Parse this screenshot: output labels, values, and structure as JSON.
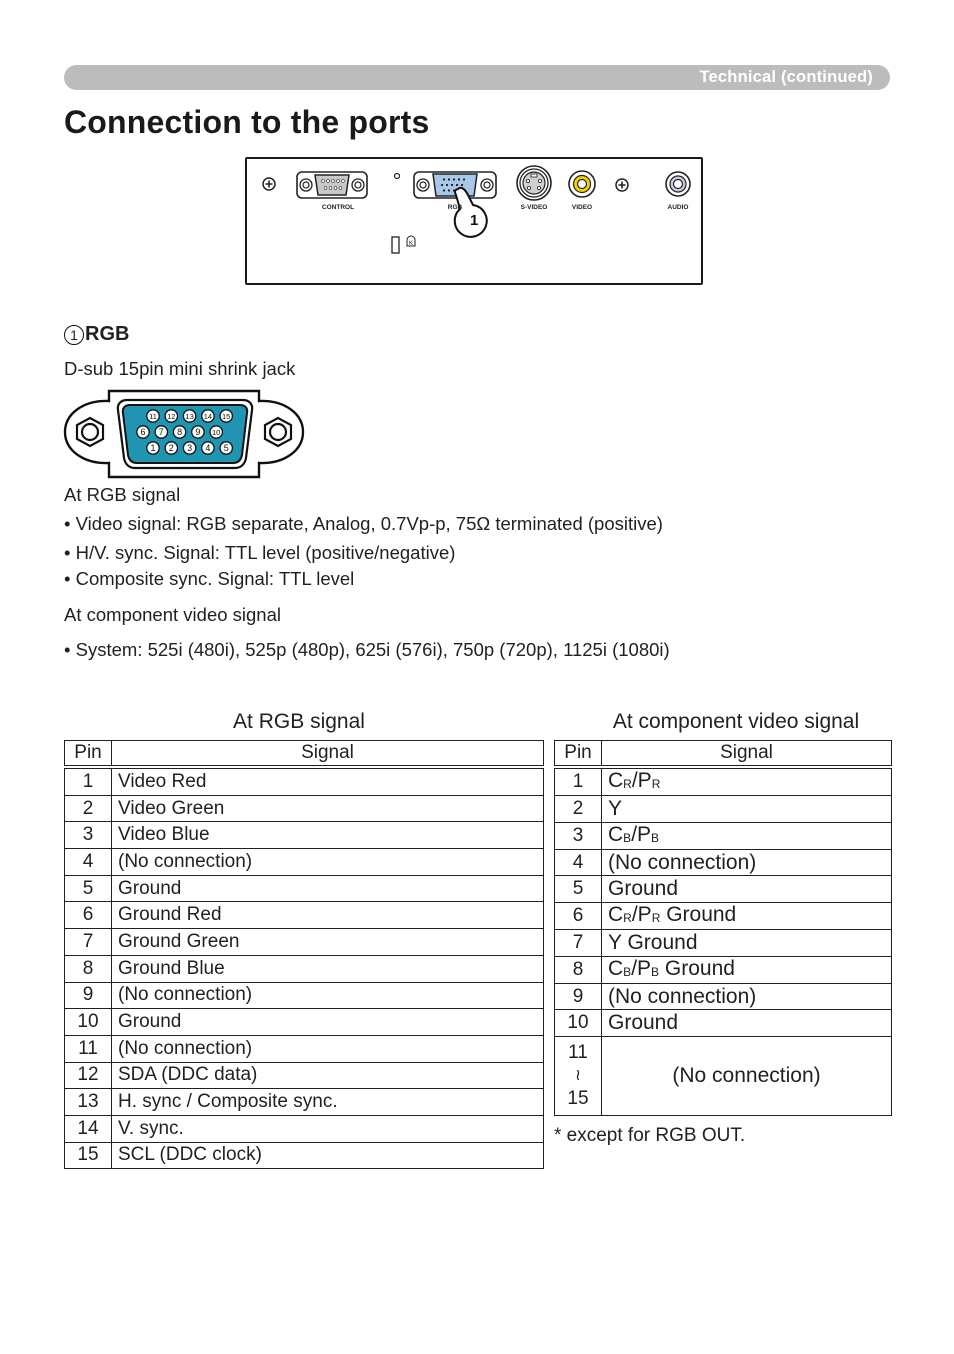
{
  "header": {
    "section_label": "Technical (continued)"
  },
  "page_title": "Connection to the ports",
  "panel": {
    "ports": [
      {
        "name": "control",
        "label": "CONTROL",
        "icon": "dsub-9pin-icon"
      },
      {
        "name": "rgb",
        "label": "RGB",
        "icon": "dsub-15pin-icon"
      },
      {
        "name": "s-video",
        "label": "S-VIDEO",
        "icon": "mini-din-icon"
      },
      {
        "name": "video",
        "label": "VIDEO",
        "icon": "rca-yellow-icon"
      },
      {
        "name": "audio",
        "label": "AUDIO",
        "icon": "stereo-jack-icon"
      }
    ],
    "callout": "1",
    "colors": {
      "rgb_port_fill": "#a9c8e8",
      "video_ring": "#f4d400",
      "audio_ring": "#c9c9e6",
      "control_fill": "#c8c8c8"
    }
  },
  "rgb_section": {
    "number": "1",
    "heading": "RGB",
    "subtitle": "D-sub 15pin mini shrink jack",
    "connector_color": "#1f95b2",
    "pin_rows": [
      [
        "11",
        "12",
        "13",
        "14",
        "15"
      ],
      [
        "6",
        "7",
        "8",
        "9",
        "10"
      ],
      [
        "1",
        "2",
        "3",
        "4",
        "5"
      ]
    ],
    "at_rgb_heading": "At RGB signal",
    "rgb_bullets": [
      "• Video signal: RGB separate, Analog, 0.7Vp-p, 75Ω terminated (positive)",
      "• H/V. sync. Signal: TTL level (positive/negative)",
      "• Composite sync. Signal: TTL level"
    ],
    "at_component_heading": "At component video signal",
    "component_bullets": [
      "• System: 525i (480i), 525p (480p), 625i (576i), 750p (720p), 1125i (1080i)"
    ]
  },
  "rgb_table": {
    "title": "At RGB signal",
    "headers": [
      "Pin",
      "Signal"
    ],
    "rows": [
      {
        "pin": "1",
        "signal": "Video Red"
      },
      {
        "pin": "2",
        "signal": "Video Green"
      },
      {
        "pin": "3",
        "signal": "Video Blue"
      },
      {
        "pin": "4",
        "signal": "(No connection)"
      },
      {
        "pin": "5",
        "signal": "Ground"
      },
      {
        "pin": "6",
        "signal": "Ground Red"
      },
      {
        "pin": "7",
        "signal": "Ground Green"
      },
      {
        "pin": "8",
        "signal": "Ground Blue"
      },
      {
        "pin": "9",
        "signal": "(No connection)"
      },
      {
        "pin": "10",
        "signal": "Ground"
      },
      {
        "pin": "11",
        "signal": "(No connection)"
      },
      {
        "pin": "12",
        "signal": "SDA (DDC data)"
      },
      {
        "pin": "13",
        "signal": "H. sync / Composite sync."
      },
      {
        "pin": "14",
        "signal": "V. sync."
      },
      {
        "pin": "15",
        "signal": "SCL (DDC clock)"
      }
    ]
  },
  "component_table": {
    "title": "At component video signal",
    "headers": [
      "Pin",
      "Signal"
    ],
    "rows": [
      {
        "pin": "1",
        "main": "C",
        "sub1": "R",
        "mid": "/P",
        "sub2": "R",
        "suffix": ""
      },
      {
        "pin": "2",
        "main": "Y",
        "sub1": "",
        "mid": "",
        "sub2": "",
        "suffix": ""
      },
      {
        "pin": "3",
        "main": "C",
        "sub1": "B",
        "mid": "/P",
        "sub2": "B",
        "suffix": ""
      },
      {
        "pin": "4",
        "main": "(No connection)",
        "sub1": "",
        "mid": "",
        "sub2": "",
        "suffix": ""
      },
      {
        "pin": "5",
        "main": "Ground",
        "sub1": "",
        "mid": "",
        "sub2": "",
        "suffix": ""
      },
      {
        "pin": "6",
        "main": "C",
        "sub1": "R",
        "mid": "/P",
        "sub2": "R",
        "suffix": " Ground"
      },
      {
        "pin": "7",
        "main": "Y Ground",
        "sub1": "",
        "mid": "",
        "sub2": "",
        "suffix": ""
      },
      {
        "pin": "8",
        "main": "C",
        "sub1": "B",
        "mid": "/P",
        "sub2": "B",
        "suffix": " Ground"
      },
      {
        "pin": "9",
        "main": "(No connection)",
        "sub1": "",
        "mid": "",
        "sub2": "",
        "suffix": ""
      },
      {
        "pin": "10",
        "main": "Ground",
        "sub1": "",
        "mid": "",
        "sub2": "",
        "suffix": ""
      }
    ],
    "range_row": {
      "pin_start": "11",
      "range_symbol": "≀",
      "pin_end": "15",
      "signal": "(No connection)"
    },
    "footnote": "* except for RGB OUT."
  }
}
